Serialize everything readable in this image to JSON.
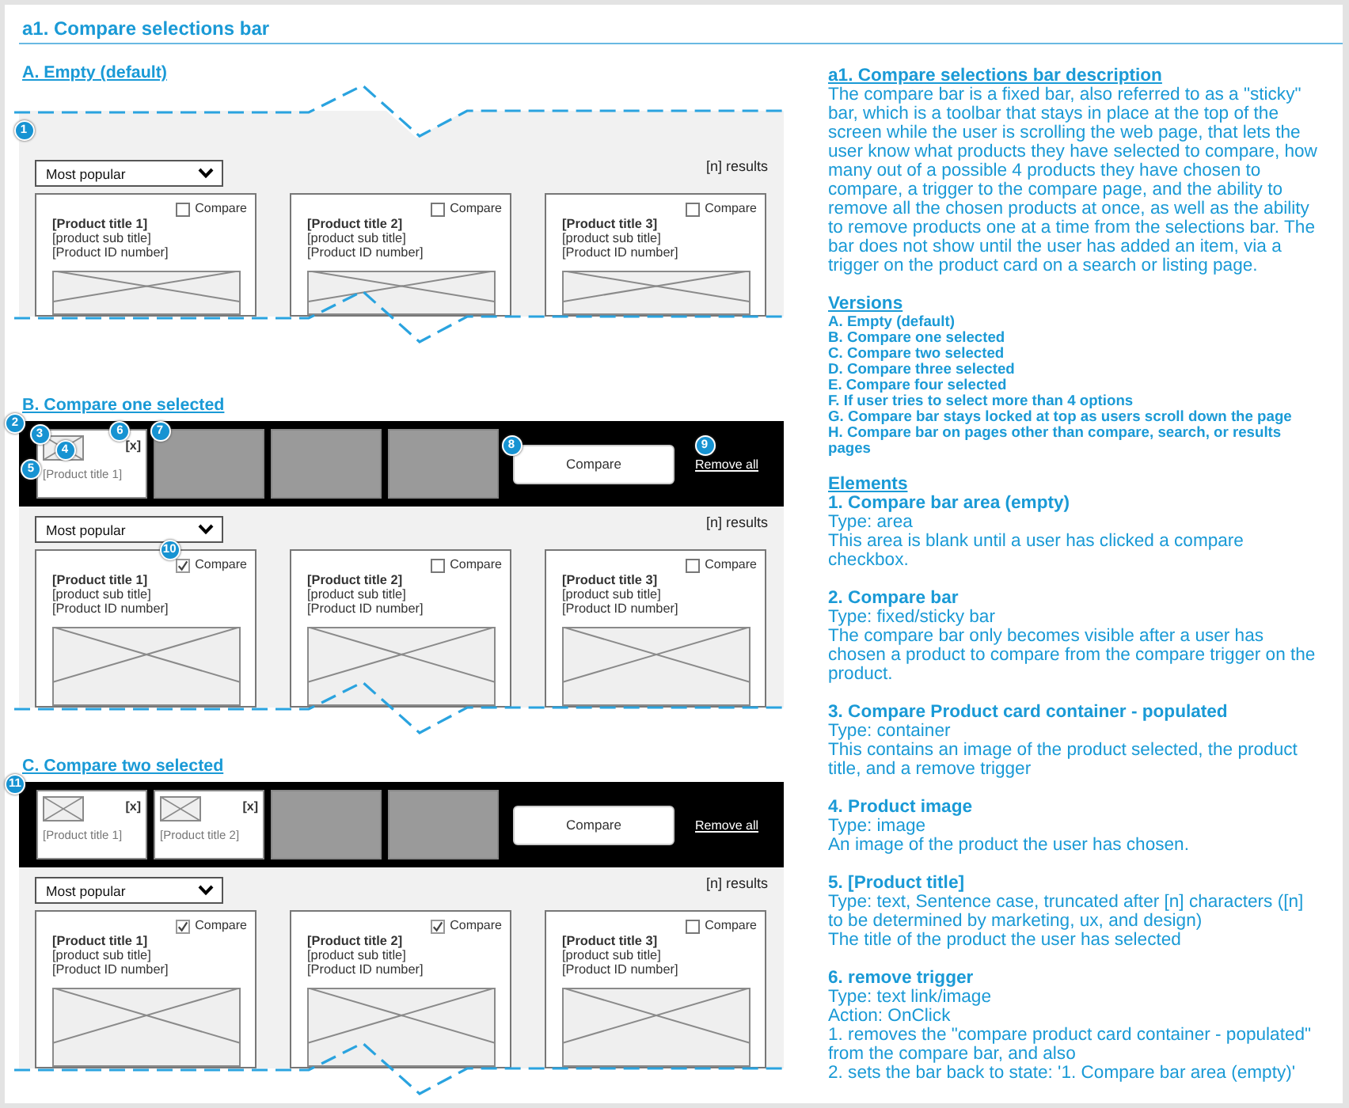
{
  "title": "a1. Compare selections bar",
  "sections": [
    {
      "heading": "A. Empty (default)",
      "empty_area": {
        "callout": "1"
      },
      "sort": {
        "label": "Most popular"
      },
      "results": "[n] results",
      "products": [
        {
          "title": "[Product title 1]",
          "subtitle": "[product sub title]",
          "id_number": "[Product ID number]",
          "compare_label": "Compare",
          "checked": false
        },
        {
          "title": "[Product title 2]",
          "subtitle": "[product sub title]",
          "id_number": "[Product ID number]",
          "compare_label": "Compare",
          "checked": false
        },
        {
          "title": "[Product title 3]",
          "subtitle": "[product sub title]",
          "id_number": "[Product ID number]",
          "compare_label": "Compare",
          "checked": false
        }
      ]
    },
    {
      "heading": "B. Compare one selected",
      "compare_bar": {
        "callout": "2",
        "slots": [
          {
            "kind": "product",
            "title": "[Product title 1]",
            "remove": "[x]",
            "callout": "3",
            "image_callout": "4",
            "title_callout": "5",
            "remove_callout": "6"
          },
          {
            "kind": "empty",
            "callout": "7"
          },
          {
            "kind": "empty"
          },
          {
            "kind": "empty"
          }
        ],
        "compare_button": {
          "label": "Compare",
          "callout": "8"
        },
        "remove_all": {
          "label": "Remove all",
          "callout": "9"
        }
      },
      "sort": {
        "label": "Most popular"
      },
      "results": "[n] results",
      "products": [
        {
          "title": "[Product title 1]",
          "subtitle": "[product sub title]",
          "id_number": "[Product ID number]",
          "compare_label": "Compare",
          "checked": true,
          "callout": "10"
        },
        {
          "title": "[Product title 2]",
          "subtitle": "[product sub title]",
          "id_number": "[Product ID number]",
          "compare_label": "Compare",
          "checked": false
        },
        {
          "title": "[Product title 3]",
          "subtitle": "[product sub title]",
          "id_number": "[Product ID number]",
          "compare_label": "Compare",
          "checked": false
        }
      ]
    },
    {
      "heading": "C. Compare two selected",
      "compare_bar": {
        "callout": "11",
        "slots": [
          {
            "kind": "product",
            "title": "[Product title 1]",
            "remove": "[x]"
          },
          {
            "kind": "product",
            "title": "[Product title 2]",
            "remove": "[x]"
          },
          {
            "kind": "empty"
          },
          {
            "kind": "empty"
          }
        ],
        "compare_button": {
          "label": "Compare"
        },
        "remove_all": {
          "label": "Remove all"
        }
      },
      "sort": {
        "label": "Most popular"
      },
      "results": "[n] results",
      "products": [
        {
          "title": "[Product title 1]",
          "subtitle": "[product sub title]",
          "id_number": "[Product ID number]",
          "compare_label": "Compare",
          "checked": true
        },
        {
          "title": "[Product title 2]",
          "subtitle": "[product sub title]",
          "id_number": "[Product ID number]",
          "compare_label": "Compare",
          "checked": true
        },
        {
          "title": "[Product title 3]",
          "subtitle": "[product sub title]",
          "id_number": "[Product ID number]",
          "compare_label": "Compare",
          "checked": false
        }
      ]
    }
  ],
  "description": {
    "heading": "a1. Compare selections bar description",
    "text": "The compare bar is a fixed bar, also referred to as a \"sticky\" bar, which is a toolbar that stays in place at the top of the screen while the user is scrolling the web page, that lets the user know what products they have selected to compare, how many out of a possible 4 products they have chosen to compare, a trigger to the compare page, and the ability to remove all the chosen products at once, as well as the ability to remove products one at a time from the selections bar. The bar does not show until the user has added an item, via a trigger on the product card on a search or listing page."
  },
  "versions": {
    "heading": "Versions",
    "items": [
      "A. Empty (default)",
      "B. Compare one selected",
      "C. Compare two selected",
      "D. Compare three selected",
      "E. Compare four selected",
      "F. If user tries to select more than 4 options",
      "G. Compare bar stays locked at top as users scroll down the page",
      "H. Compare bar on pages other than compare, search, or results pages"
    ]
  },
  "elements": {
    "heading": "Elements",
    "items": [
      {
        "title": "1. Compare bar area (empty)",
        "lines": [
          "Type: area",
          "This area is blank until a user has clicked a compare checkbox."
        ]
      },
      {
        "title": "2. Compare bar",
        "lines": [
          "Type: fixed/sticky bar",
          "The compare bar only becomes visible after a user has chosen a product to compare from the compare trigger on the product."
        ]
      },
      {
        "title": "3. Compare Product card container - populated",
        "lines": [
          "Type: container",
          "This contains an image of the product selected, the product title, and a remove trigger"
        ]
      },
      {
        "title": "4. Product image",
        "lines": [
          "Type: image",
          "An image of the product the user has chosen."
        ]
      },
      {
        "title": "5. [Product title]",
        "lines": [
          "Type: text, Sentence case, truncated after [n] characters ([n] to be determined by marketing, ux, and design)",
          "The title of the product the user has selected"
        ]
      },
      {
        "title": "6. remove trigger",
        "lines": [
          "Type: text link/image",
          "Action: OnClick",
          "1. removes the \"compare product card container - populated\" from the compare bar, and also",
          "2. sets the bar back to state: '1. Compare bar area (empty)'"
        ]
      }
    ]
  }
}
